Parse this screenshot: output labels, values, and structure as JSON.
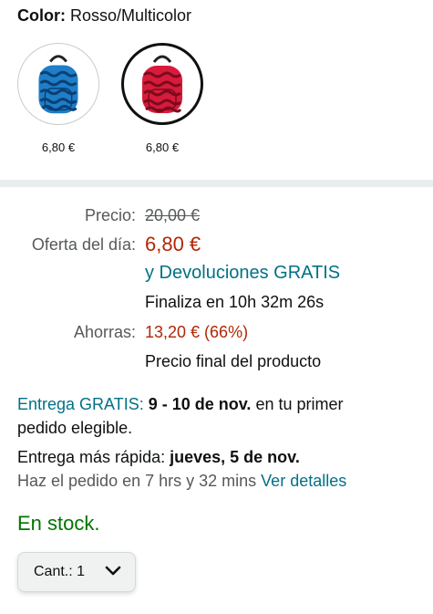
{
  "variant": {
    "color_label": "Color:",
    "color_value": "Rosso/Multicolor",
    "swatches": [
      {
        "name": "blue",
        "price": "6,80 €",
        "color": "#1e7ec8",
        "selected": false
      },
      {
        "name": "red",
        "price": "6,80 €",
        "color": "#d81b3b",
        "selected": true
      }
    ]
  },
  "price": {
    "list_label": "Precio:",
    "list_price": "20,00 €",
    "deal_label": "Oferta del día:",
    "deal_price": "6,80 €",
    "returns_link": "y Devoluciones GRATIS",
    "ends_in": "Finaliza en 10h 32m 26s",
    "savings_label": "Ahorras:",
    "savings": "13,20 € (66%)",
    "final_note": "Precio final del producto"
  },
  "delivery": {
    "free_label": "Entrega GRATIS:",
    "free_dates": "9 - 10 de nov.",
    "free_suffix": "en tu primer",
    "free_line2": "pedido elegible.",
    "fast_prefix": "Entrega más rápida:",
    "fast_date": "jueves, 5 de nov.",
    "order_within": "Haz el pedido en 7 hrs y 32 mins",
    "details_link": "Ver detalles"
  },
  "stock": "En stock.",
  "quantity": {
    "label": "Cant.:",
    "value": "1"
  },
  "colors": {
    "link": "#007185",
    "price_red": "#b12704",
    "stock_green": "#007600"
  }
}
